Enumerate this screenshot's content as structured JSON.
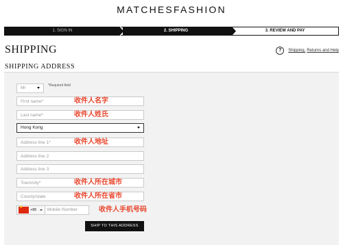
{
  "brand": "MATCHESFASHION",
  "steps": [
    {
      "label": "1. SIGN IN"
    },
    {
      "label": "2. SHIPPING"
    },
    {
      "label": "3. REVIEW AND PAY"
    }
  ],
  "page_title": "SHIPPING",
  "help": {
    "prefix": "Shipping,",
    "label": "Returns and Help",
    "icon": "?"
  },
  "section_title": "SHIPPING ADDRESS",
  "form": {
    "title_value": "Mr",
    "required_note": "*Required field",
    "first_name_placeholder": "First name*",
    "last_name_placeholder": "Last name*",
    "country_value": "Hong Kong",
    "address1_placeholder": "Address line 1*",
    "address2_placeholder": "Address line 2",
    "address3_placeholder": "Address line 3",
    "town_placeholder": "Town/city*",
    "county_placeholder": "County/state",
    "dial_code": "+86",
    "mobile_placeholder": "Mobile Number",
    "submit_label": "SHIP TO THIS ADDRESS"
  },
  "hints": {
    "first_name": "收件人名字",
    "last_name": "收件人姓氏",
    "address": "收件人地址",
    "town": "收件人所在城市",
    "county": "收件人所在省市",
    "mobile": "收件人手机号码"
  },
  "colors": {
    "hint": "#e8452c",
    "dark": "#111111",
    "panel": "#f2f2f2"
  }
}
